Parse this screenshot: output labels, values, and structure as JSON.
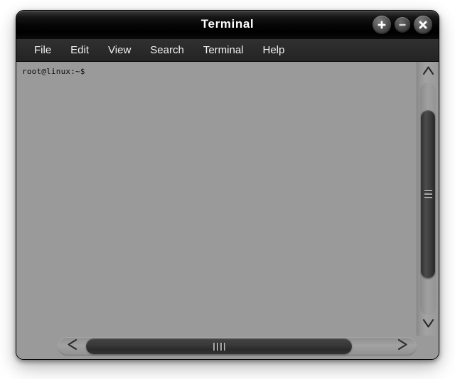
{
  "window": {
    "title": "Terminal",
    "controls": [
      {
        "name": "maximize-button",
        "icon": "plus-icon",
        "glyph": "+"
      },
      {
        "name": "minimize-button",
        "icon": "minus-icon",
        "glyph": "−"
      },
      {
        "name": "close-button",
        "icon": "close-icon",
        "glyph": "×"
      }
    ]
  },
  "menubar": {
    "items": [
      {
        "label": "File"
      },
      {
        "label": "Edit"
      },
      {
        "label": "View"
      },
      {
        "label": "Search"
      },
      {
        "label": "Terminal"
      },
      {
        "label": "Help"
      }
    ]
  },
  "terminal": {
    "prompt": "root@linux:~$",
    "lines": [
      "root@linux:~$"
    ],
    "background_color": "#9a9a9a",
    "text_color": "#0b0b0b"
  },
  "scrollbars": {
    "vertical": {
      "up_arrow_icon": "chevron-up-icon",
      "down_arrow_icon": "chevron-down-icon",
      "grip_count": 3
    },
    "horizontal": {
      "left_arrow_icon": "chevron-left-icon",
      "right_arrow_icon": "chevron-right-icon",
      "grip_count": 4
    }
  },
  "colors": {
    "titlebar": "#000000",
    "menubar": "#2a2a2a",
    "terminal_bg": "#9a9a9a",
    "scrollbar_track": "#9a9a9a",
    "scrollbar_thumb": "#333333",
    "page_bg": "#ffffff"
  }
}
